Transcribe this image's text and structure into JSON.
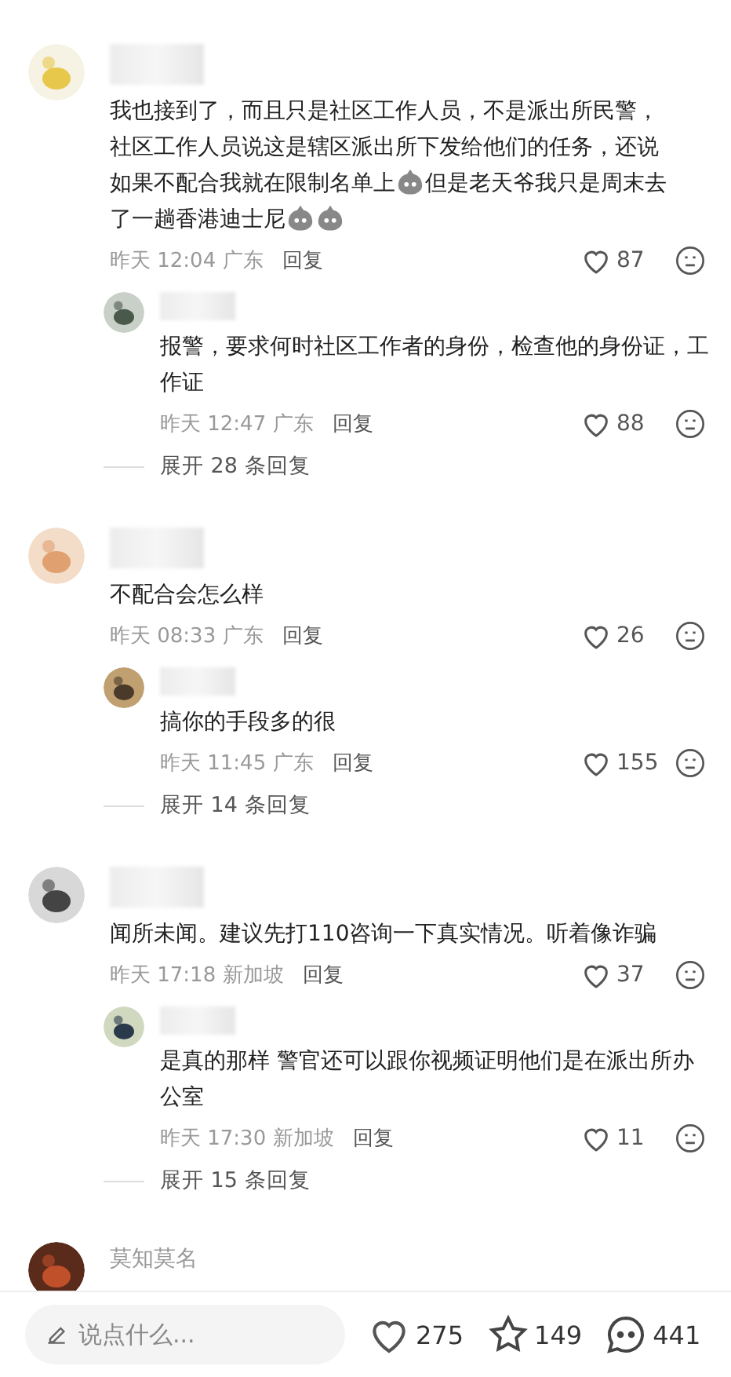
{
  "comments": [
    {
      "body": [
        {
          "kind": "text",
          "text": "我也接到了，而且只是社区工作人员，不是派出所民警，"
        },
        {
          "kind": "text",
          "text": "社区工作人员说这是辖区派出所下发给他们的任务，还说"
        },
        {
          "kind": "text",
          "text": "如果不配合我就在限制名单上"
        },
        {
          "kind": "sticker"
        },
        {
          "kind": "text",
          "text": "但是老天爷我只是周末去"
        },
        {
          "kind": "text",
          "text": "了一趟香港迪士尼"
        },
        {
          "kind": "sticker"
        },
        {
          "kind": "sticker"
        }
      ],
      "time": "昨天 12:04",
      "place": "广东",
      "reply": "回复",
      "likes": "87",
      "replies": [
        {
          "body": [
            {
              "kind": "text",
              "text": "报警，要求何时社区工作者的身份，检查他的身份证，工作证"
            }
          ],
          "time": "昨天 12:47",
          "place": "广东",
          "reply": "回复",
          "likes": "88"
        }
      ],
      "expand": "展开 28 条回复"
    },
    {
      "body": [
        {
          "kind": "text",
          "text": "不配合会怎么样"
        }
      ],
      "time": "昨天 08:33",
      "place": "广东",
      "reply": "回复",
      "likes": "26",
      "replies": [
        {
          "body": [
            {
              "kind": "text",
              "text": "搞你的手段多的很"
            }
          ],
          "time": "昨天 11:45",
          "place": "广东",
          "reply": "回复",
          "likes": "155"
        }
      ],
      "expand": "展开 14 条回复"
    },
    {
      "body": [
        {
          "kind": "text",
          "text": "闻所未闻。建议先打110咨询一下真实情况。听着像诈骗"
        }
      ],
      "time": "昨天 17:18",
      "place": "新加坡",
      "reply": "回复",
      "likes": "37",
      "replies": [
        {
          "body": [
            {
              "kind": "text",
              "text": "是真的那样 警官还可以跟你视频证明他们是在派出所办公室"
            }
          ],
          "time": "昨天 17:30",
          "place": "新加坡",
          "reply": "回复",
          "likes": "11"
        }
      ],
      "expand": "展开 15 条回复"
    },
    {
      "name": "莫知莫名"
    }
  ],
  "bottom_bar": {
    "placeholder": "说点什么...",
    "likes": "275",
    "stars": "149",
    "comments": "441"
  }
}
